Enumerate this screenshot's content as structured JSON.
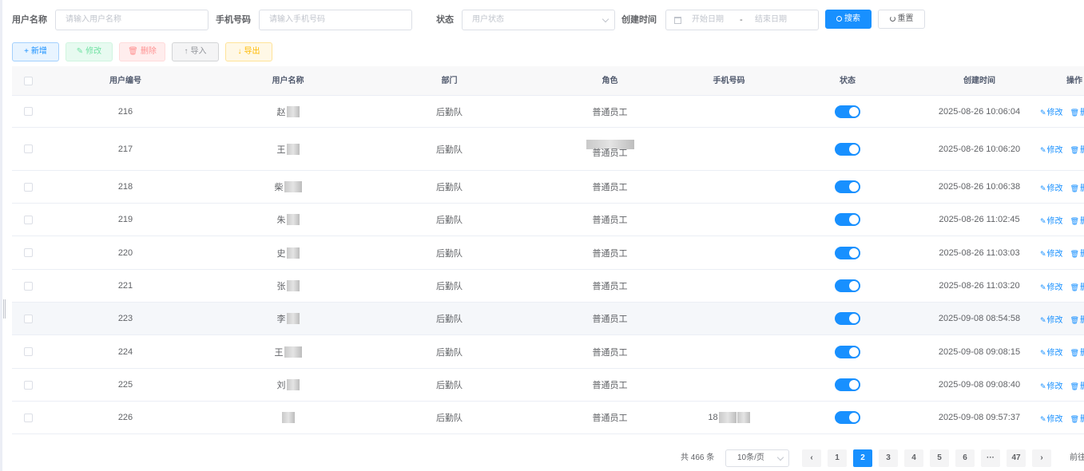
{
  "search": {
    "username_label": "用户名称",
    "username_placeholder": "请输入用户名称",
    "phone_label": "手机号码",
    "phone_placeholder": "请输入手机号码",
    "status_label": "状态",
    "status_placeholder": "用户状态",
    "created_label": "创建时间",
    "start_date_placeholder": "开始日期",
    "range_separator": "-",
    "end_date_placeholder": "结束日期",
    "search_button": "搜索",
    "reset_button": "重置"
  },
  "toolbar": {
    "add": "新增",
    "edit": "修改",
    "delete": "删除",
    "import": "导入",
    "export": "导出"
  },
  "table": {
    "headers": {
      "id": "用户编号",
      "name": "用户名称",
      "dept": "部门",
      "role": "角色",
      "phone": "手机号码",
      "status": "状态",
      "created": "创建时间",
      "ops": "操作"
    },
    "edit_link": "修改",
    "delete_link": "删除",
    "rows": [
      {
        "id": "216",
        "name": "赵",
        "dept": "后勤队",
        "role": "普通员工",
        "role_extra": "",
        "phone": "",
        "status": true,
        "created": "2025-08-26 10:06:04"
      },
      {
        "id": "217",
        "name": "王",
        "dept": "后勤队",
        "role": "普通员工",
        "role_extra": "",
        "phone": "",
        "status": true,
        "created": "2025-08-26 10:06:20"
      },
      {
        "id": "218",
        "name": "柴",
        "dept": "后勤队",
        "role": "普通员工",
        "role_extra": "",
        "phone": "",
        "status": true,
        "created": "2025-08-26 10:06:38"
      },
      {
        "id": "219",
        "name": "朱",
        "dept": "后勤队",
        "role": "普通员工",
        "role_extra": "",
        "phone": "",
        "status": true,
        "created": "2025-08-26 11:02:45"
      },
      {
        "id": "220",
        "name": "史",
        "dept": "后勤队",
        "role": "普通员工",
        "role_extra": "",
        "phone": "",
        "status": true,
        "created": "2025-08-26 11:03:03"
      },
      {
        "id": "221",
        "name": "张",
        "dept": "后勤队",
        "role": "普通员工",
        "role_extra": "",
        "phone": "",
        "status": true,
        "created": "2025-08-26 11:03:20"
      },
      {
        "id": "223",
        "name": "李",
        "dept": "后勤队",
        "role": "普通员工",
        "role_extra": "",
        "phone": "",
        "status": true,
        "created": "2025-09-08 08:54:58"
      },
      {
        "id": "224",
        "name": "王",
        "dept": "后勤队",
        "role": "普通员工",
        "role_extra": "",
        "phone": "",
        "status": true,
        "created": "2025-09-08 09:08:15"
      },
      {
        "id": "225",
        "name": "刘",
        "dept": "后勤队",
        "role": "普通员工",
        "role_extra": "",
        "phone": "",
        "status": true,
        "created": "2025-09-08 09:08:40"
      },
      {
        "id": "226",
        "name": "",
        "dept": "后勤队",
        "role": "普通员工",
        "role_extra": "",
        "phone": "18",
        "status": true,
        "created": "2025-09-08 09:57:37"
      }
    ]
  },
  "pagination": {
    "total": "共 466 条",
    "page_size": "10条/页",
    "pages": [
      "1",
      "2",
      "3",
      "4",
      "5",
      "6",
      "···",
      "47"
    ],
    "current": "2",
    "goto": "前往"
  },
  "colors": {
    "primary": "#1890ff",
    "switch_on": "#1890ff"
  }
}
